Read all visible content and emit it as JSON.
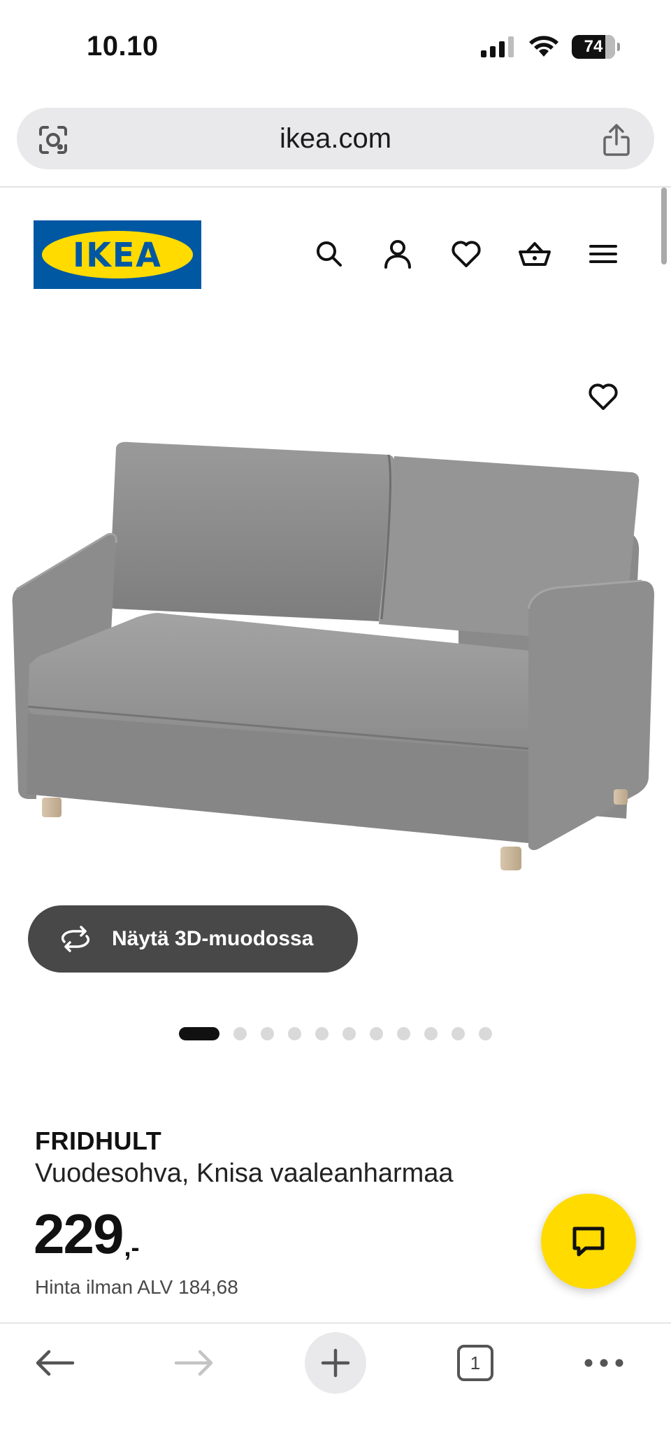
{
  "status_bar": {
    "time": "10.10",
    "battery": "74"
  },
  "browser": {
    "url": "ikea.com",
    "tab_count": "1"
  },
  "site": {
    "logo_text": "IKEA",
    "brand_colors": {
      "blue": "#0058a3",
      "yellow": "#ffdb00"
    }
  },
  "header_icons": [
    "search-icon",
    "account-icon",
    "heart-icon",
    "basket-icon",
    "menu-icon"
  ],
  "gallery": {
    "view_3d_label": "Näytä 3D-muodossa",
    "image_count": 11,
    "active_index": 0
  },
  "product": {
    "name": "FRIDHULT",
    "description": "Vuodesohva, Knisa vaaleanharmaa",
    "price_main": "229",
    "price_suffix": ",-",
    "vat_label": "Hinta ilman ALV",
    "vat_value": "184,68"
  },
  "toolbar_icons": [
    "back-icon",
    "forward-icon",
    "plus-icon",
    "tabs-icon",
    "more-icon"
  ]
}
